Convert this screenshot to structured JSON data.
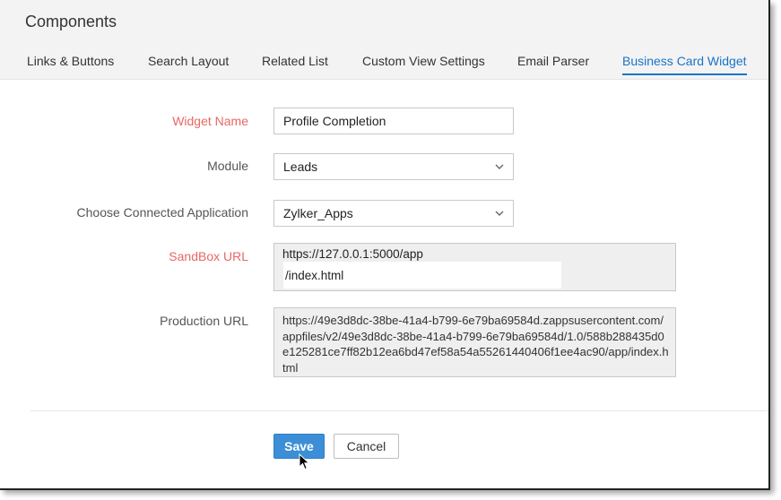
{
  "header": {
    "title": "Components"
  },
  "tabs": [
    {
      "label": "Links & Buttons",
      "active": false
    },
    {
      "label": "Search Layout",
      "active": false
    },
    {
      "label": "Related List",
      "active": false
    },
    {
      "label": "Custom View Settings",
      "active": false
    },
    {
      "label": "Email Parser",
      "active": false
    },
    {
      "label": "Business Card Widget",
      "active": true
    }
  ],
  "form": {
    "widget_name": {
      "label": "Widget Name",
      "value": "Profile Completion"
    },
    "module": {
      "label": "Module",
      "value": "Leads"
    },
    "connected_app": {
      "label": "Choose Connected Application",
      "value": "Zylker_Apps"
    },
    "sandbox_url": {
      "label": "SandBox URL",
      "prefix": "https://127.0.0.1:5000/app",
      "value": "/index.html"
    },
    "production_url": {
      "label": "Production URL",
      "value": "https://49e3d8dc-38be-41a4-b799-6e79ba69584d.zappsusercontent.com/appfiles/v2/49e3d8dc-38be-41a4-b799-6e79ba69584d/1.0/588b288435d0e125281ce7ff82b12ea6bd47ef58a54a55261440406f1ee4ac90/app/index.html"
    }
  },
  "actions": {
    "save_label": "Save",
    "cancel_label": "Cancel"
  },
  "colors": {
    "accent": "#1874c8",
    "required": "#e76864",
    "save_button": "#3c8fd6"
  }
}
